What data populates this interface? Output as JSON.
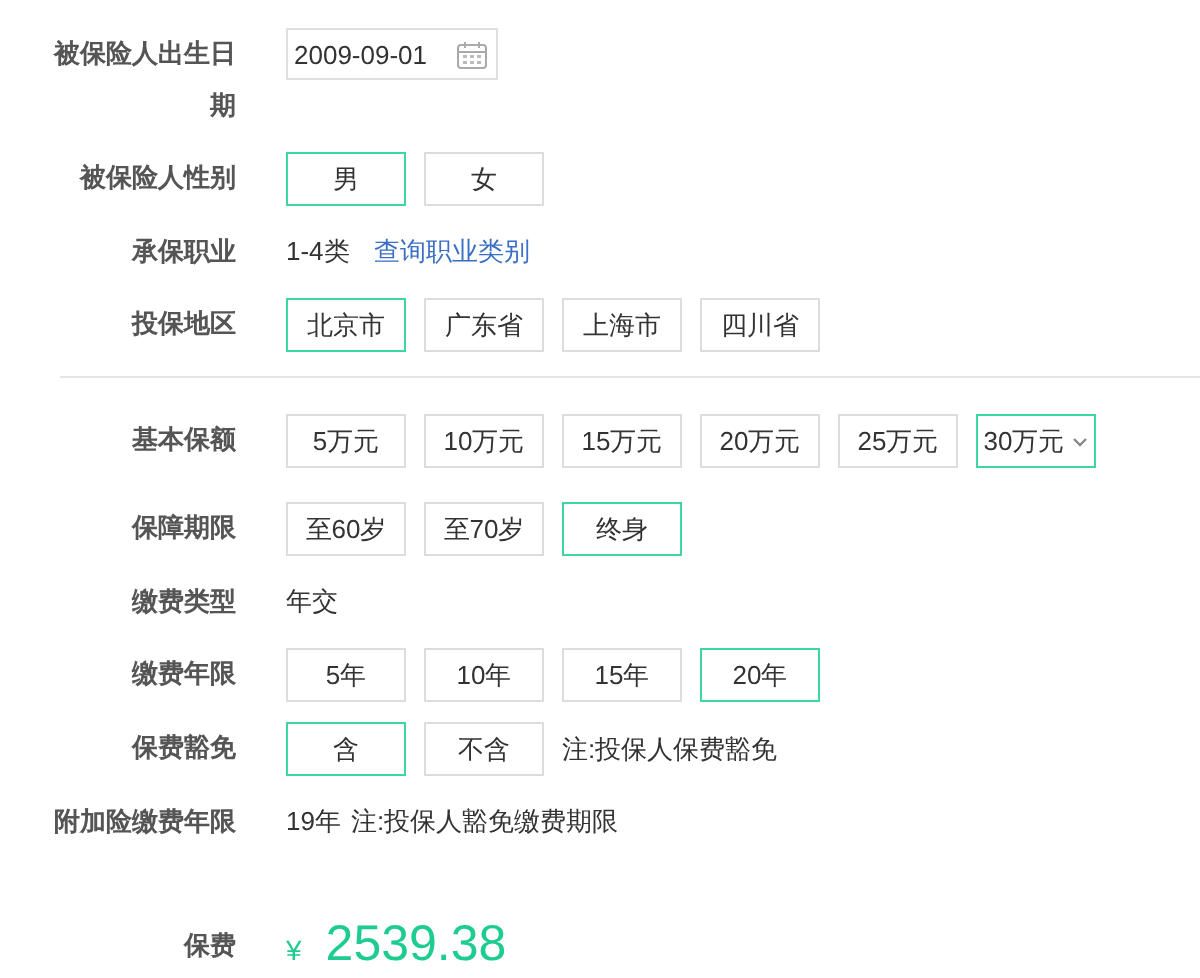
{
  "sections": [
    {
      "rows": [
        {
          "kind": "date",
          "label": "被保险人出生日期",
          "value": "2009-09-01"
        },
        {
          "kind": "options",
          "label": "被保险人性别",
          "options": [
            {
              "label": "男",
              "selected": true
            },
            {
              "label": "女",
              "selected": false
            }
          ]
        },
        {
          "kind": "text",
          "label": "承保职业",
          "value": "1-4类",
          "link": "查询职业类别"
        },
        {
          "kind": "options",
          "label": "投保地区",
          "options": [
            {
              "label": "北京市",
              "selected": true
            },
            {
              "label": "广东省",
              "selected": false
            },
            {
              "label": "上海市",
              "selected": false
            },
            {
              "label": "四川省",
              "selected": false
            }
          ]
        }
      ]
    },
    {
      "rows": [
        {
          "kind": "options",
          "label": "基本保额",
          "options": [
            {
              "label": "5万元",
              "selected": false
            },
            {
              "label": "10万元",
              "selected": false
            },
            {
              "label": "15万元",
              "selected": false
            },
            {
              "label": "20万元",
              "selected": false
            },
            {
              "label": "25万元",
              "selected": false
            },
            {
              "label": "30万元",
              "selected": true,
              "dropdown": true
            }
          ]
        },
        {
          "kind": "options",
          "label": "保障期限",
          "options": [
            {
              "label": "至60岁",
              "selected": false
            },
            {
              "label": "至70岁",
              "selected": false
            },
            {
              "label": "终身",
              "selected": true
            }
          ]
        },
        {
          "kind": "text",
          "label": "缴费类型",
          "value": "年交"
        },
        {
          "kind": "options",
          "label": "缴费年限",
          "options": [
            {
              "label": "5年",
              "selected": false
            },
            {
              "label": "10年",
              "selected": false
            },
            {
              "label": "15年",
              "selected": false
            },
            {
              "label": "20年",
              "selected": true
            }
          ]
        },
        {
          "kind": "options",
          "label": "保费豁免",
          "options": [
            {
              "label": "含",
              "selected": true
            },
            {
              "label": "不含",
              "selected": false
            }
          ],
          "note": "注:投保人保费豁免"
        },
        {
          "kind": "text",
          "label": "附加险缴费年限",
          "value": "19年",
          "note": "注:投保人豁免缴费期限"
        }
      ]
    }
  ],
  "premium": {
    "label": "保费",
    "currency": "¥",
    "amount": "2539.38"
  }
}
